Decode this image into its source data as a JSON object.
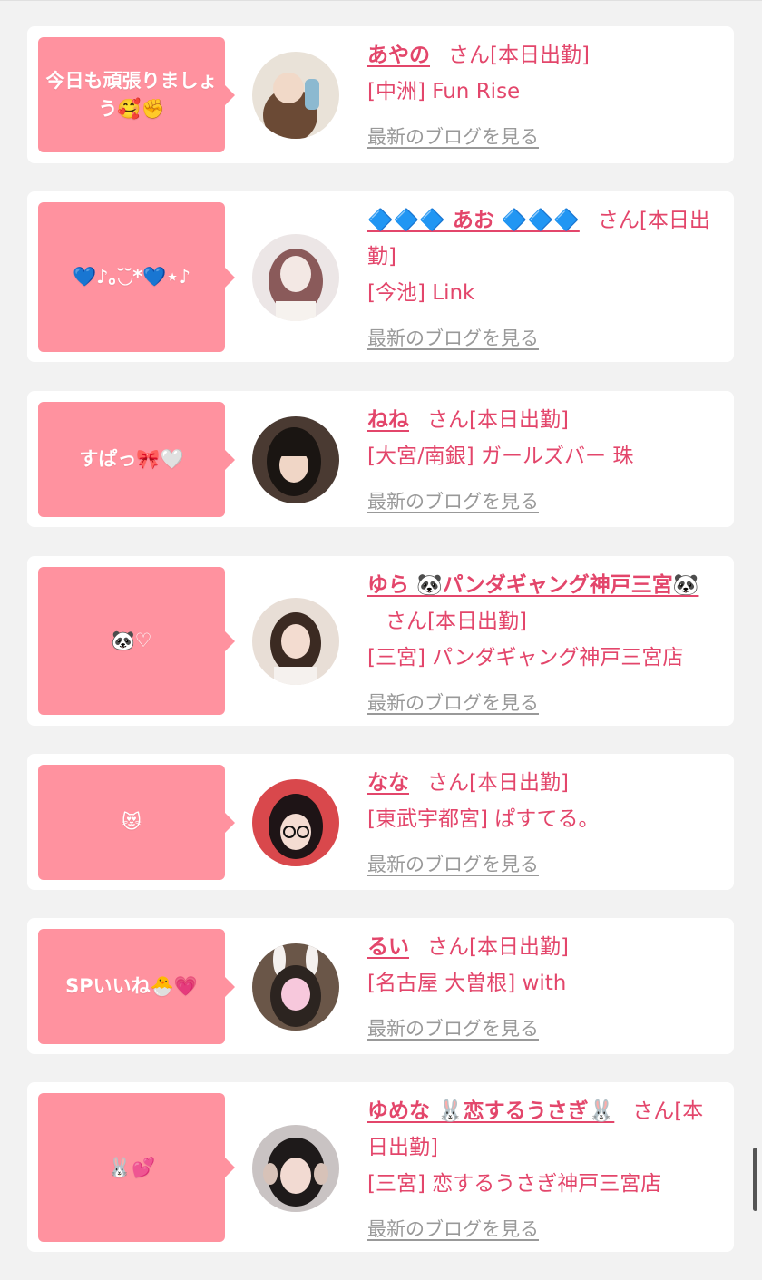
{
  "cards": [
    {
      "bubble": "今日も頑張りましょう🥰✊",
      "name": "あやの",
      "san": "さん[本日出勤]",
      "shop": "[中洲] Fun Rise",
      "blog": "最新のブログを見る",
      "avatar_colors": [
        "#e9e2d8",
        "#6b4a35",
        "#f1d9c8"
      ]
    },
    {
      "bubble": "💙♪｡◟̆◞̆*💙⋆♪",
      "name": "🔷🔷🔷 あお 🔷🔷🔷",
      "san": "さん[本日出勤]",
      "shop": "[今池] Link",
      "blog": "最新のブログを見る",
      "avatar_colors": [
        "#ece6e6",
        "#8a5a5a",
        "#f3e8e4"
      ]
    },
    {
      "bubble": "すぱっ🎀🤍",
      "name": "ねね",
      "san": "さん[本日出勤]",
      "shop": "[大宮/南銀] ガールズバー 珠",
      "blog": "最新のブログを見る",
      "avatar_colors": [
        "#4a3a32",
        "#1a1512",
        "#f0d6c6"
      ]
    },
    {
      "bubble": "🐼♡",
      "name": "ゆら 🐼パンダギャング神戸三宮🐼",
      "san": "さん[本日出勤]",
      "shop": "[三宮] パンダギャング神戸三宮店",
      "blog": "最新のブログを見る",
      "avatar_colors": [
        "#e8ded6",
        "#3b2a22",
        "#f3dcd0"
      ]
    },
    {
      "bubble": "😻",
      "name": "なな",
      "san": "さん[本日出勤]",
      "shop": "[東武宇都宮] ぱすてる。",
      "blog": "最新のブログを見る",
      "avatar_colors": [
        "#d9484c",
        "#1e1416",
        "#f4dcd2"
      ]
    },
    {
      "bubble": "SPいいね🐣💗",
      "name": "るい",
      "san": "さん[本日出勤]",
      "shop": "[名古屋 大曽根] with",
      "blog": "最新のブログを見る",
      "avatar_colors": [
        "#6a5648",
        "#2c2420",
        "#f7c8dc"
      ]
    },
    {
      "bubble": "🐰💕",
      "name": "ゆめな 🐰恋するうさぎ🐰",
      "san": "さん[本日出勤]",
      "shop": "[三宮] 恋するうさぎ神戸三宮店",
      "blog": "最新のブログを見る",
      "avatar_colors": [
        "#c9c3c3",
        "#1e1a1a",
        "#f2dad2"
      ]
    }
  ]
}
